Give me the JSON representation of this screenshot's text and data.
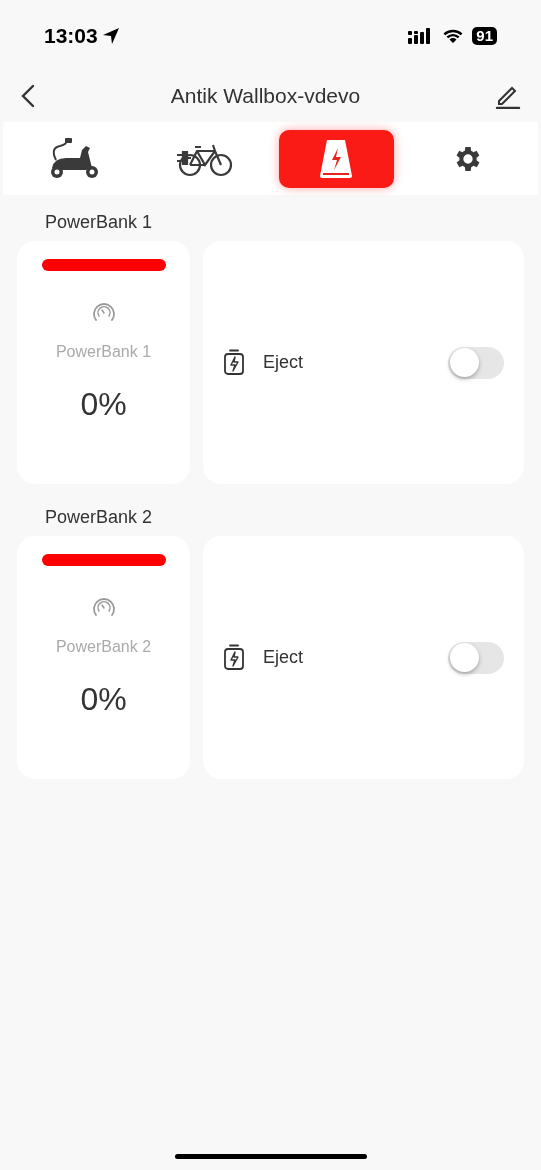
{
  "status_bar": {
    "time": "13:03",
    "battery": "91"
  },
  "nav": {
    "title": "Antik Wallbox-vdevo"
  },
  "tabs": [
    {
      "kind": "scooter",
      "selected": false
    },
    {
      "kind": "bike",
      "selected": false
    },
    {
      "kind": "powerbank",
      "selected": true
    },
    {
      "kind": "settings",
      "selected": false
    }
  ],
  "powerbanks": [
    {
      "heading": "PowerBank 1",
      "color": "#ff0000",
      "name": "PowerBank 1",
      "percent": "0%",
      "action": "Eject",
      "on": false
    },
    {
      "heading": "PowerBank 2",
      "color": "#ff0000",
      "name": "PowerBank 2",
      "percent": "0%",
      "action": "Eject",
      "on": false
    }
  ]
}
